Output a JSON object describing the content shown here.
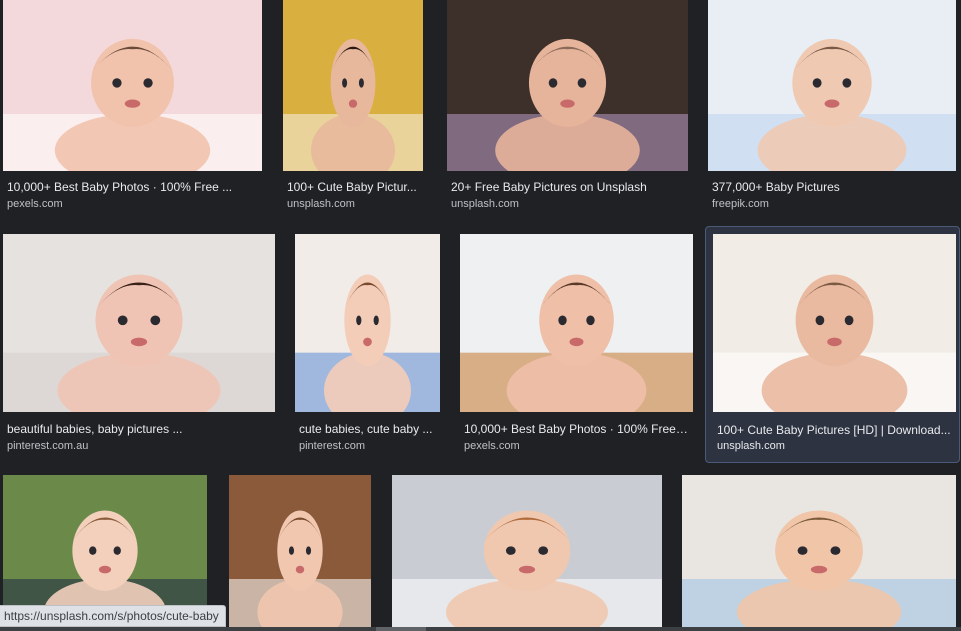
{
  "results": [
    {
      "title": "10,000+ Best Baby Photos · 100% Free ...",
      "source": "pexels.com",
      "palette": {
        "bg": "#f3d9dc",
        "skin": "#f1c3ad",
        "hair": "#6b4a37",
        "accent": "#ffffff"
      }
    },
    {
      "title": "100+ Cute Baby Pictur...",
      "source": "unsplash.com",
      "palette": {
        "bg": "#d9b040",
        "skin": "#e8b89c",
        "hair": "#2a1a12",
        "accent": "#f5f0e6"
      }
    },
    {
      "title": "20+ Free Baby Pictures on Unsplash",
      "source": "unsplash.com",
      "palette": {
        "bg": "#3d2f29",
        "skin": "#e6b49a",
        "hair": "#8c6a5a",
        "accent": "#b89ac9"
      }
    },
    {
      "title": "377,000+ Baby Pictures",
      "source": "freepik.com",
      "palette": {
        "bg": "#e8eef4",
        "skin": "#f0c9b2",
        "hair": "#7a5a44",
        "accent": "#bcd4ee"
      }
    },
    {
      "title": "beautiful babies, baby pictures ...",
      "source": "pinterest.com.au",
      "palette": {
        "bg": "#e6e2df",
        "skin": "#f0c4b4",
        "hair": "#3a2218",
        "accent": "#d5d0cc"
      }
    },
    {
      "title": "cute babies, cute baby ...",
      "source": "pinterest.com",
      "palette": {
        "bg": "#f2ece8",
        "skin": "#f4cdb8",
        "hair": "#7a4c2e",
        "accent": "#5c8ed6"
      }
    },
    {
      "title": "10,000+ Best Baby Photos · 100% Free ...",
      "source": "pexels.com",
      "palette": {
        "bg": "#eef0f2",
        "skin": "#efbfa8",
        "hair": "#5a3a28",
        "accent": "#c7792e"
      }
    },
    {
      "title": "100+ Cute Baby Pictures [HD] | Download...",
      "source": "unsplash.com",
      "palette": {
        "bg": "#f1ece6",
        "skin": "#e9b9a0",
        "hair": "#7a5a40",
        "accent": "#ffffff"
      }
    },
    {
      "title": "",
      "source": "",
      "palette": {
        "bg": "#6b8a4a",
        "skin": "#f2d0bc",
        "hair": "#8a5a3a",
        "accent": "#1e2a44"
      }
    },
    {
      "title": "",
      "source": "",
      "palette": {
        "bg": "#8a5a3a",
        "skin": "#f1c7b0",
        "hair": "#7a4c2e",
        "accent": "#ffffff"
      }
    },
    {
      "title": "",
      "source": "",
      "palette": {
        "bg": "#c9ccd2",
        "skin": "#f0c8b0",
        "hair": "#b06a3a",
        "accent": "#ffffff"
      }
    },
    {
      "title": "",
      "source": "",
      "palette": {
        "bg": "#e9e5e1",
        "skin": "#f0c5a8",
        "hair": "#7a5a3a",
        "accent": "#9cc2e6"
      }
    }
  ],
  "status_url": "https://unsplash.com/s/photos/cute-baby"
}
